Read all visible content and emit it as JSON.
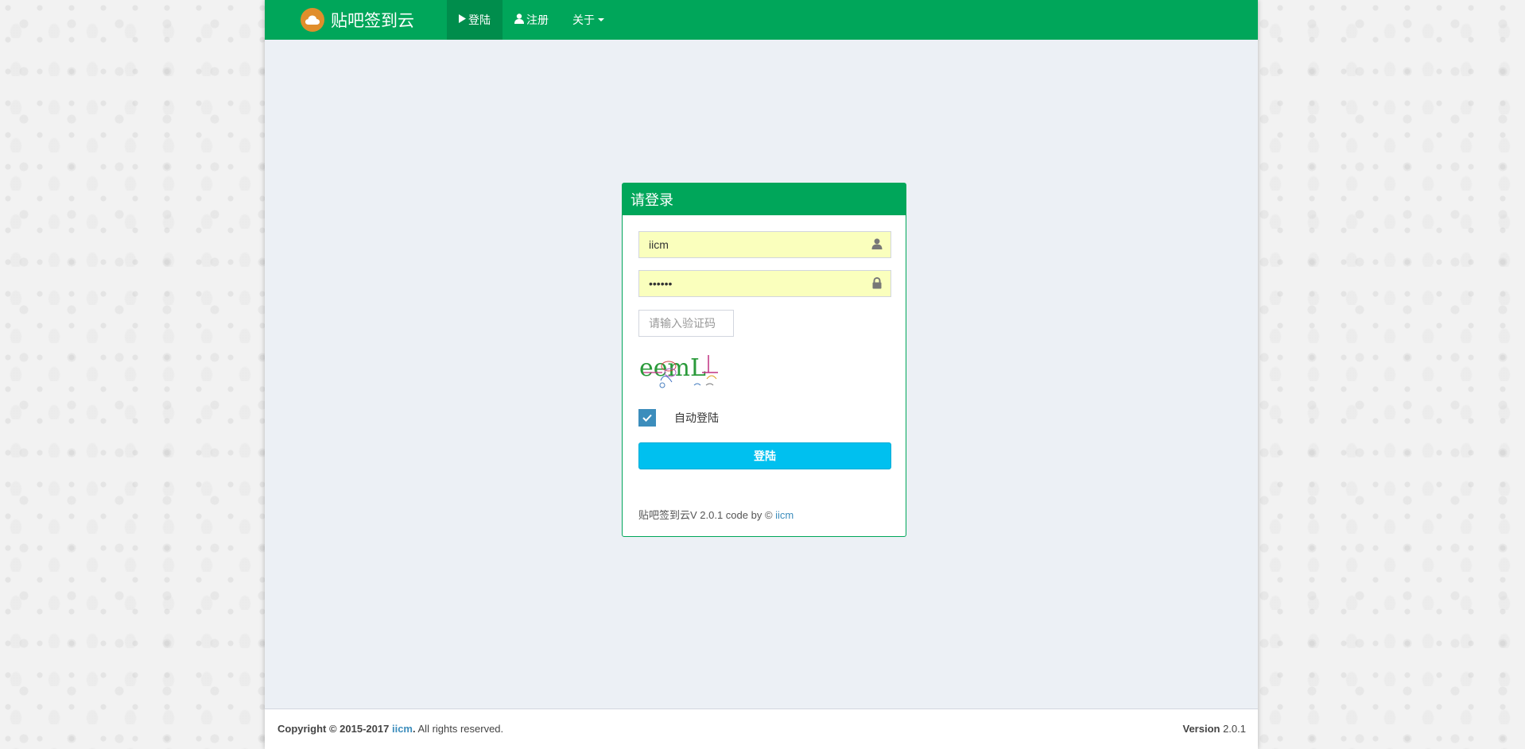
{
  "header": {
    "brand": "贴吧签到云",
    "nav": [
      {
        "label": "登陆",
        "icon": "play-icon",
        "active": true
      },
      {
        "label": "注册",
        "icon": "user-icon",
        "active": false
      },
      {
        "label": "关于",
        "icon": "caret-down-icon",
        "active": false
      }
    ]
  },
  "login": {
    "title": "请登录",
    "username_value": "iicm",
    "password_value": "iicmpw",
    "captcha_placeholder": "请输入验证码",
    "captcha_text": "eemL",
    "remember_label": "自动登陆",
    "remember_checked": true,
    "submit_label": "登陆",
    "footer_product": "贴吧签到云V",
    "footer_version_text": " 2.0.1 code by © ",
    "footer_author": "iicm"
  },
  "footer": {
    "copyright_prefix": "Copyright © 2015-2017 ",
    "copyright_link": "iicm",
    "copyright_suffix": ". All rights reserved.",
    "version_label": "Version",
    "version_value": " 2.0.1"
  },
  "colors": {
    "primary": "#00a65a",
    "primary_dark": "#008d4c",
    "button": "#00c0ef",
    "autofill": "#faffbd",
    "checkbox": "#3c8dbc",
    "link": "#3c8dbc"
  }
}
